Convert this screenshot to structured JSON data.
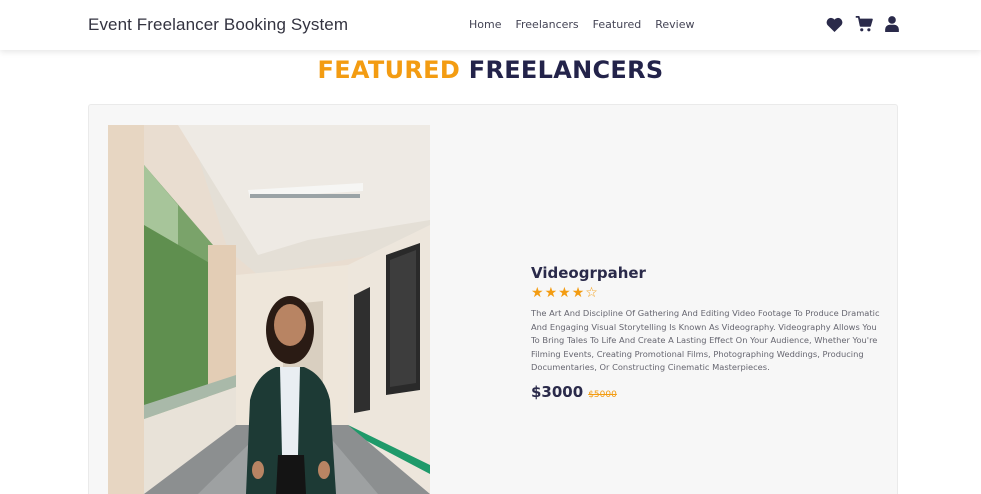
{
  "header": {
    "brand": "Event Freelancer Booking System",
    "nav": [
      {
        "label": "Home"
      },
      {
        "label": "Freelancers"
      },
      {
        "label": "Featured"
      },
      {
        "label": "Review"
      }
    ],
    "icons": [
      "heart-icon",
      "cart-icon",
      "user-icon"
    ]
  },
  "section": {
    "title_accent": "FEATURED",
    "title_main": "FREELANCERS"
  },
  "featured": {
    "name": "Videogrpaher",
    "rating": 4,
    "rating_max": 5,
    "description": "The Art And Discipline Of Gathering And Editing Video Footage To Produce Dramatic And Engaging Visual Storytelling Is Known As Videography. Videography Allows You To Bring Tales To Life And Create A Lasting Effect On Your Audience, Whether You're Filming Events, Creating Promotional Films, Photographing Weddings, Producing Documentaries, Or Constructing Cinematic Masterpieces.",
    "price": "$3000",
    "old_price": "$5000"
  },
  "colors": {
    "accent": "#f39c12",
    "heading": "#23234a",
    "card_bg": "#f7f7f7"
  }
}
